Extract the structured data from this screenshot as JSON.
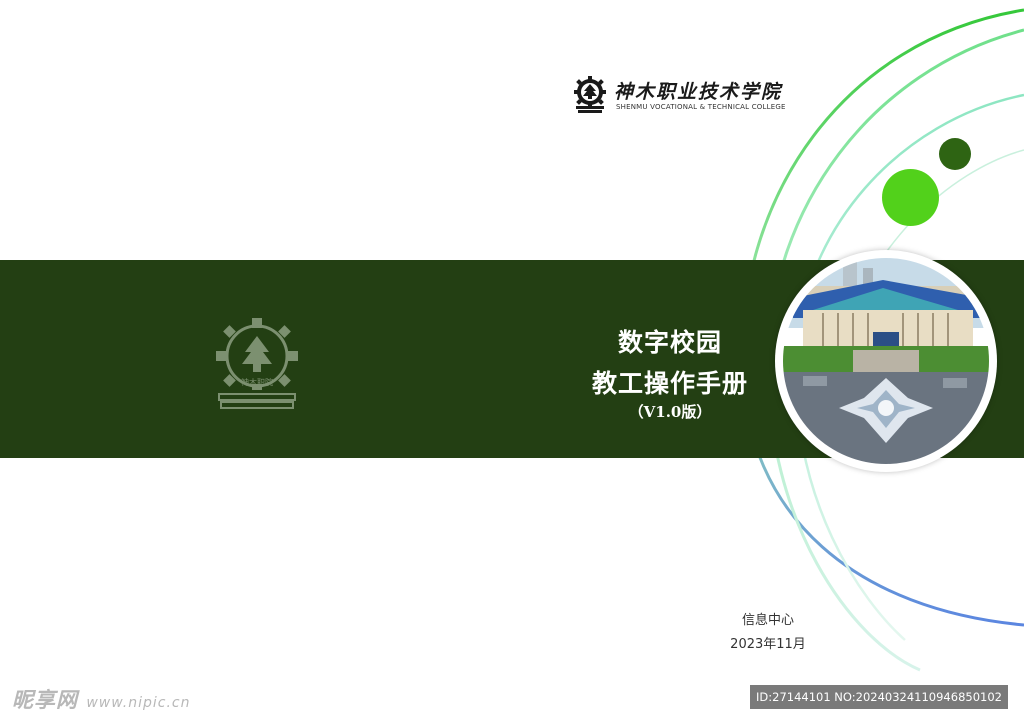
{
  "college": {
    "name_cn": "神木职业技术学院",
    "name_en": "SHENMU VOCATIONAL & TECHNICAL COLLEGE",
    "emblem_icon": "gear-tree-book-emblem"
  },
  "band": {
    "color": "#233f13",
    "title_line1": "数字校园",
    "title_line2": "教工操作手册",
    "version": "（V1.0版）",
    "watermark_logo_icon": "gear-tree-book-emblem",
    "watermark_logo_text": "神木职院",
    "photo_icon": "campus-building-photo"
  },
  "footer": {
    "department": "信息中心",
    "date": "2023年11月"
  },
  "decor": {
    "dot_light_color": "#52d11b",
    "dot_dark_color": "#2e6413"
  },
  "watermark": {
    "site_name": "昵享网",
    "site_url": "www.nipic.cn",
    "id_text": "ID:27144101 NO:20240324110946850102"
  }
}
